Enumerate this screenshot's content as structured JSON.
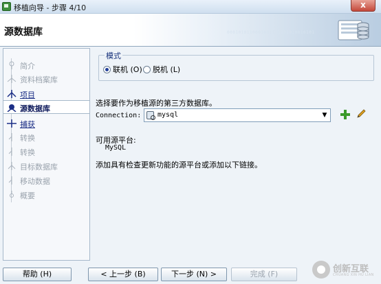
{
  "window": {
    "title": "移植向导 - 步骤 4/10",
    "close_label": "x"
  },
  "header": {
    "page_title": "源数据库",
    "binary_text": "0001010110001001111101010010101"
  },
  "nav": {
    "items": [
      {
        "label": "简介",
        "state": "disabled"
      },
      {
        "label": "资料档案库",
        "state": "disabled"
      },
      {
        "label": "项目",
        "state": "link"
      },
      {
        "label": "源数据库",
        "state": "active"
      },
      {
        "label": "捕获",
        "state": "link"
      },
      {
        "label": "转换",
        "state": "disabled"
      },
      {
        "label": "转换",
        "state": "disabled"
      },
      {
        "label": "目标数据库",
        "state": "disabled"
      },
      {
        "label": "移动数据",
        "state": "disabled"
      },
      {
        "label": "概要",
        "state": "disabled"
      }
    ]
  },
  "mode": {
    "legend": "模式",
    "online_label": "联机 (O)",
    "offline_label": "脱机 (L)",
    "selected": "online"
  },
  "source": {
    "prompt": "选择要作为移植源的第三方数据库。",
    "connection_label": "Connection:",
    "connection_value": "mysql"
  },
  "platform": {
    "label": "可用源平台:",
    "value": "MySQL",
    "hint": "添加具有检查更新功能的源平台或添加以下链接。"
  },
  "footer": {
    "help_label": "帮助 (H)",
    "back_label": "< 上一步 (B)",
    "next_label": "下一步 (N) >",
    "finish_label": "完成 (F)"
  },
  "watermark": {
    "text": "创新互联",
    "sub": "CHUANG XIN HU LIAN"
  },
  "colors": {
    "accent": "#1c2f86",
    "add": "#3a9a2a"
  },
  "icons": [
    "app-icon",
    "database-graphic-icon",
    "database-icon",
    "add-icon",
    "edit-pencil-icon",
    "dropdown-arrow-icon"
  ]
}
